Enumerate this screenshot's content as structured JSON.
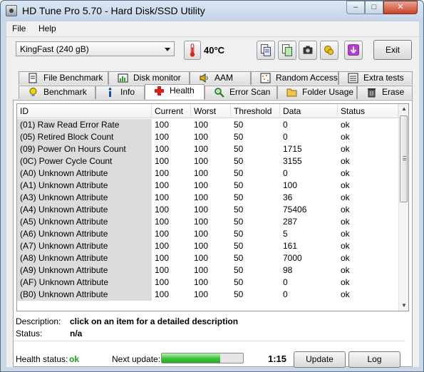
{
  "window": {
    "title": "HD Tune Pro 5.70 - Hard Disk/SSD Utility",
    "min_glyph": "–",
    "max_glyph": "□",
    "close_glyph": "✕"
  },
  "menu": {
    "file": "File",
    "help": "Help"
  },
  "toolbar": {
    "drive": "KingFast (240 gB)",
    "temperature": "40°C",
    "exit_label": "Exit"
  },
  "tabs": {
    "back_row": [
      {
        "label": "File Benchmark",
        "icon": "file-benchmark-icon"
      },
      {
        "label": "Disk monitor",
        "icon": "disk-monitor-icon"
      },
      {
        "label": "AAM",
        "icon": "speaker-icon"
      },
      {
        "label": "Random Access",
        "icon": "random-access-icon"
      },
      {
        "label": "Extra tests",
        "icon": "extra-tests-icon"
      }
    ],
    "front_row": [
      {
        "label": "Benchmark",
        "icon": "lightbulb-icon"
      },
      {
        "label": "Info",
        "icon": "info-icon"
      },
      {
        "label": "Health",
        "icon": "health-cross-icon",
        "active": true
      },
      {
        "label": "Error Scan",
        "icon": "magnifier-icon"
      },
      {
        "label": "Folder Usage",
        "icon": "folder-icon"
      },
      {
        "label": "Erase",
        "icon": "trash-icon"
      }
    ]
  },
  "grid": {
    "columns": [
      "ID",
      "Current",
      "Worst",
      "Threshold",
      "Data",
      "Status"
    ],
    "rows": [
      [
        "(01) Raw Read Error Rate",
        "100",
        "100",
        "50",
        "0",
        "ok"
      ],
      [
        "(05) Retired Block Count",
        "100",
        "100",
        "50",
        "0",
        "ok"
      ],
      [
        "(09) Power On Hours Count",
        "100",
        "100",
        "50",
        "1715",
        "ok"
      ],
      [
        "(0C) Power Cycle Count",
        "100",
        "100",
        "50",
        "3155",
        "ok"
      ],
      [
        "(A0) Unknown Attribute",
        "100",
        "100",
        "50",
        "0",
        "ok"
      ],
      [
        "(A1) Unknown Attribute",
        "100",
        "100",
        "50",
        "100",
        "ok"
      ],
      [
        "(A3) Unknown Attribute",
        "100",
        "100",
        "50",
        "36",
        "ok"
      ],
      [
        "(A4) Unknown Attribute",
        "100",
        "100",
        "50",
        "75406",
        "ok"
      ],
      [
        "(A5) Unknown Attribute",
        "100",
        "100",
        "50",
        "287",
        "ok"
      ],
      [
        "(A6) Unknown Attribute",
        "100",
        "100",
        "50",
        "5",
        "ok"
      ],
      [
        "(A7) Unknown Attribute",
        "100",
        "100",
        "50",
        "161",
        "ok"
      ],
      [
        "(A8) Unknown Attribute",
        "100",
        "100",
        "50",
        "7000",
        "ok"
      ],
      [
        "(A9) Unknown Attribute",
        "100",
        "100",
        "50",
        "98",
        "ok"
      ],
      [
        "(AF) Unknown Attribute",
        "100",
        "100",
        "50",
        "0",
        "ok"
      ],
      [
        "(B0) Unknown Attribute",
        "100",
        "100",
        "50",
        "0",
        "ok"
      ]
    ]
  },
  "details": {
    "description_label": "Description:",
    "description_value": "click on an item for a detailed description",
    "status_label": "Status:",
    "status_value": "n/a"
  },
  "footer": {
    "health_label": "Health status:",
    "health_value": "ok",
    "next_update_label": "Next update:",
    "next_update_progress": 0.72,
    "next_update_time": "1:15",
    "update_label": "Update",
    "log_label": "Log"
  },
  "colors": {
    "health_ok": "#1b9e1b",
    "active_tab": "#ffffff",
    "id_column_bg": "#dcdcdc"
  }
}
